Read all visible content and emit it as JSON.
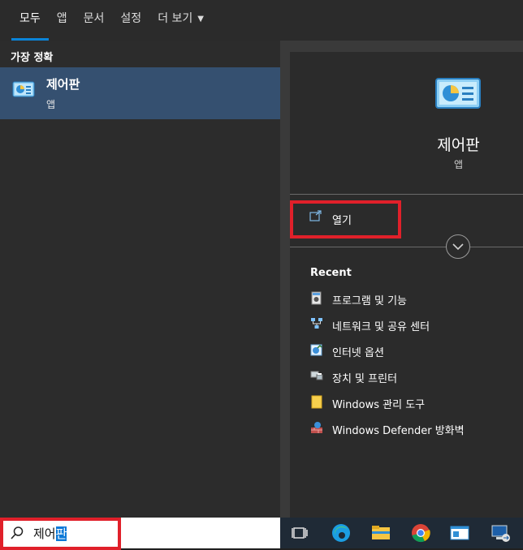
{
  "tabs": [
    {
      "label": "모두"
    },
    {
      "label": "앱"
    },
    {
      "label": "문서"
    },
    {
      "label": "설정"
    },
    {
      "label": "더 보기"
    }
  ],
  "results": {
    "section_title": "가장 정확",
    "best_match": {
      "name": "제어판",
      "type": "앱",
      "icon": "control-panel-icon"
    }
  },
  "detail": {
    "app_name": "제어판",
    "app_type": "앱",
    "open_label": "열기",
    "recent_title": "Recent",
    "recent_items": [
      {
        "label": "프로그램 및 기능",
        "icon": "programs-features-icon"
      },
      {
        "label": "네트워크 및 공유 센터",
        "icon": "network-icon"
      },
      {
        "label": "인터넷 옵션",
        "icon": "internet-options-icon"
      },
      {
        "label": "장치 및 프린터",
        "icon": "devices-printers-icon"
      },
      {
        "label": "Windows 관리 도구",
        "icon": "folder-icon"
      },
      {
        "label": "Windows Defender 방화벽",
        "icon": "firewall-icon"
      }
    ]
  },
  "search": {
    "typed": "제어",
    "selected": "판"
  },
  "taskbar": {
    "icons": [
      "task-view-icon",
      "edge-icon",
      "file-explorer-icon",
      "chrome-icon",
      "app-window-icon",
      "remote-desktop-icon"
    ]
  },
  "colors": {
    "accent": "#0a84d8",
    "highlight_box": "#e0202a",
    "selected_row": "#355070"
  }
}
